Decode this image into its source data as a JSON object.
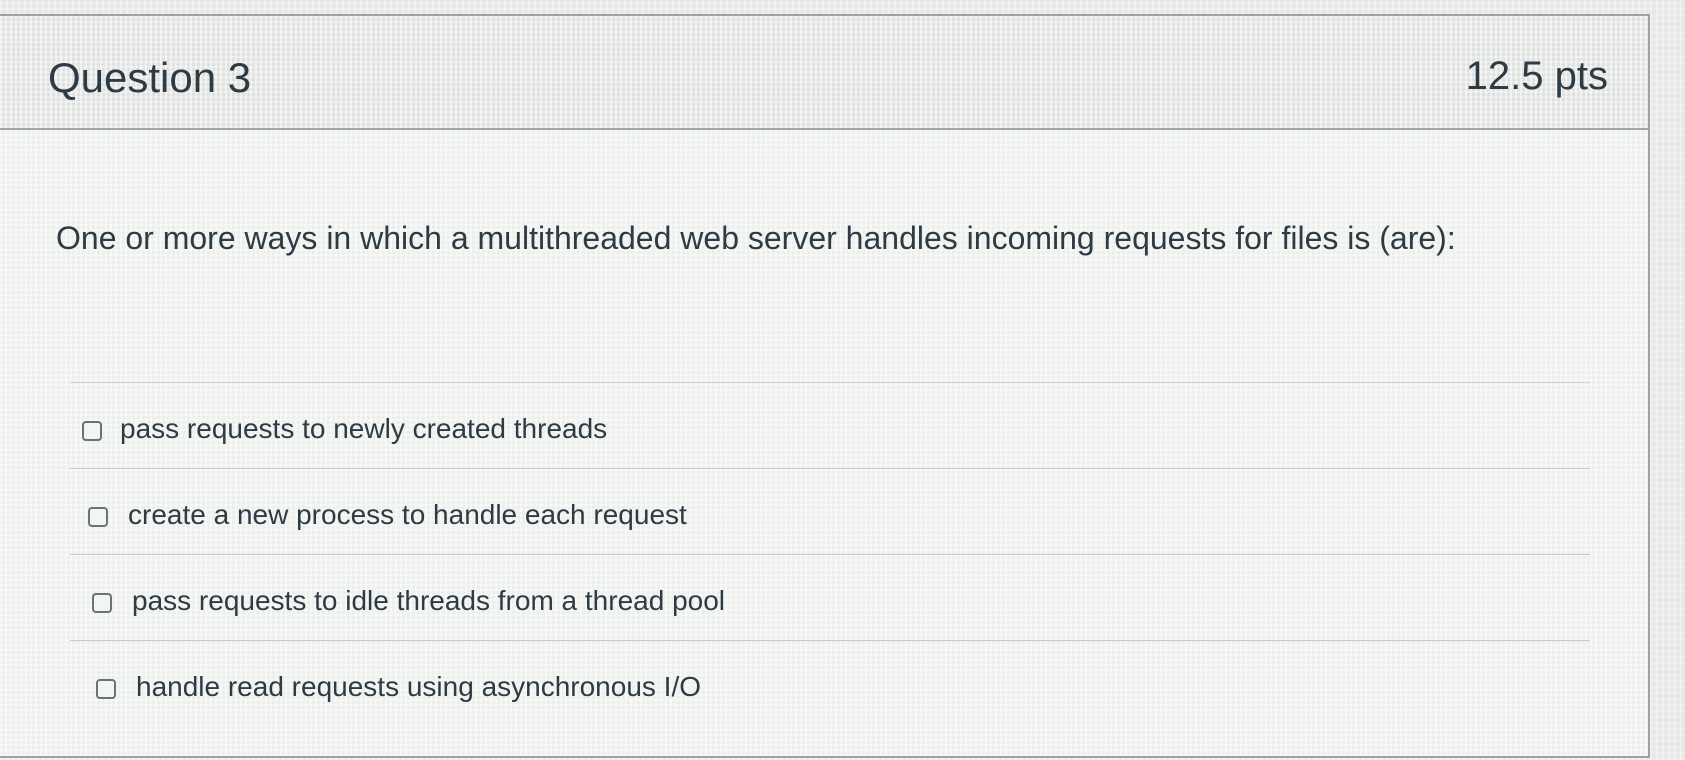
{
  "question": {
    "title": "Question 3",
    "points": "12.5 pts",
    "text": "One or more ways in which a multithreaded web server handles incoming requests for files is (are):"
  },
  "answers": [
    {
      "label": "pass requests to newly created threads",
      "checked": false
    },
    {
      "label": "create a new process to handle each request",
      "checked": false
    },
    {
      "label": "pass requests to idle threads from a thread pool",
      "checked": false
    },
    {
      "label": "handle read requests using asynchronous I/O",
      "checked": false
    }
  ]
}
